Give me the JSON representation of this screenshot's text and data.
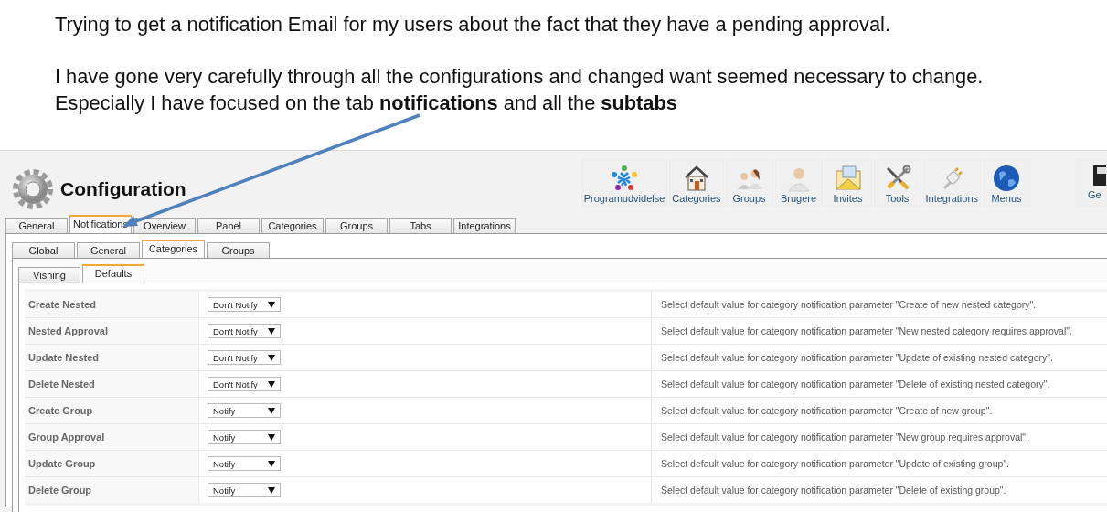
{
  "note": {
    "paragraphs": [
      "Trying to get a notification Email for my users about the fact that they have a pending approval.",
      "I have gone very carefully through all the configurations and changed want seemed necessary to change.\nEspecially I have focused on the tab **notifications** and all the **subtabs**"
    ]
  },
  "header": {
    "title": "Configuration"
  },
  "toolbar": [
    {
      "label": "Programudvidelse"
    },
    {
      "label": "Categories"
    },
    {
      "label": "Groups"
    },
    {
      "label": "Brugere"
    },
    {
      "label": "Invites"
    },
    {
      "label": "Tools"
    },
    {
      "label": "Integrations"
    },
    {
      "label": "Menus"
    },
    {
      "label": "Ge"
    }
  ],
  "tabs": [
    {
      "label": "General",
      "selected": false
    },
    {
      "label": "Notifications",
      "selected": true
    },
    {
      "label": "Overview",
      "selected": false
    },
    {
      "label": "Panel",
      "selected": false
    },
    {
      "label": "Categories",
      "selected": false
    },
    {
      "label": "Groups",
      "selected": false
    },
    {
      "label": "Tabs",
      "selected": false
    },
    {
      "label": "Integrations",
      "selected": false
    }
  ],
  "subtabs": [
    {
      "label": "Global",
      "selected": false
    },
    {
      "label": "General",
      "selected": false
    },
    {
      "label": "Categories",
      "selected": true
    },
    {
      "label": "Groups",
      "selected": false
    }
  ],
  "subsubtabs": [
    {
      "label": "Visning",
      "selected": false
    },
    {
      "label": "Defaults",
      "selected": true
    }
  ],
  "rows": [
    {
      "label": "Create Nested",
      "value": "Don't Notify",
      "description": "Select default value for category notification parameter \"Create of new nested category\"."
    },
    {
      "label": "Nested Approval",
      "value": "Don't Notify",
      "description": "Select default value for category notification parameter \"New nested category requires approval\"."
    },
    {
      "label": "Update Nested",
      "value": "Don't Notify",
      "description": "Select default value for category notification parameter \"Update of existing nested category\"."
    },
    {
      "label": "Delete Nested",
      "value": "Don't Notify",
      "description": "Select default value for category notification parameter \"Delete of existing nested category\"."
    },
    {
      "label": "Create Group",
      "value": "Notify",
      "description": "Select default value for category notification parameter \"Create of new group\"."
    },
    {
      "label": "Group Approval",
      "value": "Notify",
      "description": "Select default value for category notification parameter \"New group requires approval\"."
    },
    {
      "label": "Update Group",
      "value": "Notify",
      "description": "Select default value for category notification parameter \"Update of existing group\"."
    },
    {
      "label": "Delete Group",
      "value": "Notify",
      "description": "Select default value for category notification parameter \"Delete of existing group\"."
    }
  ]
}
